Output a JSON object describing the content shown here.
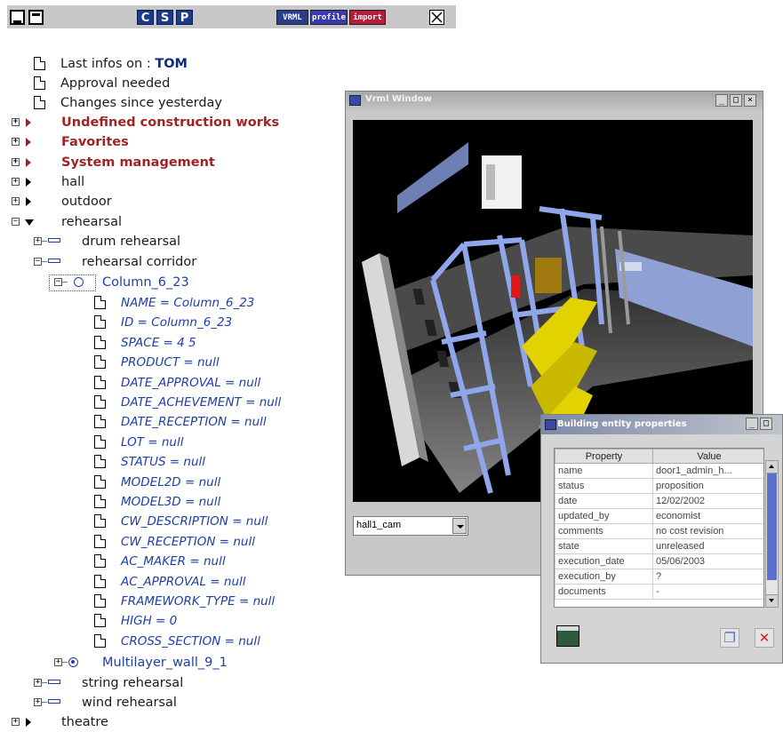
{
  "toolbar": {
    "csp": [
      "C",
      "S",
      "P"
    ],
    "tags": [
      {
        "label": "VRML",
        "color": "#2a3e8c"
      },
      {
        "label": "profile",
        "color": "#3b3ab0"
      },
      {
        "label": "import",
        "color": "#b51e3a"
      }
    ]
  },
  "tree": {
    "last_infos_prefix": "Last infos on : ",
    "last_infos_user": "TOM",
    "approval": "Approval needed",
    "changes": "Changes since yesterday",
    "groups": [
      "Undefined construction works",
      "Favorites",
      "System management"
    ],
    "hall": "hall",
    "outdoor": "outdoor",
    "rehearsal": "rehearsal",
    "drum": "drum rehearsal",
    "corridor": "rehearsal corridor",
    "column": "Column_6_23",
    "properties": [
      "NAME = Column_6_23",
      "ID = Column_6_23",
      "SPACE = 4 5",
      "PRODUCT = null",
      "DATE_APPROVAL = null",
      "DATE_ACHEVEMENT = null",
      "DATE_RECEPTION = null",
      "LOT = null",
      "STATUS = null",
      "MODEL2D = null",
      "MODEL3D = null",
      "CW_DESCRIPTION = null",
      "CW_RECEPTION = null",
      "AC_MAKER = null",
      "AC_APPROVAL = null",
      "FRAMEWORK_TYPE = null",
      "HIGH = 0",
      "CROSS_SECTION = null"
    ],
    "multilayer": "Multilayer_wall_9_1",
    "string": "string rehearsal",
    "wind": "wind rehearsal",
    "theatre": "theatre"
  },
  "vrml_window": {
    "title": "Vrml Window",
    "camera": "hall1_cam",
    "title_buttons": [
      "_",
      "□",
      "×"
    ]
  },
  "props_window": {
    "title": "Building entity properties",
    "col_property": "Property",
    "col_value": "Value",
    "rows": [
      [
        "name",
        "door1_admin_h..."
      ],
      [
        "status",
        "proposition"
      ],
      [
        "date",
        "12/02/2002"
      ],
      [
        "updated_by",
        "economist"
      ],
      [
        "comments",
        "no cost revision"
      ],
      [
        "state",
        "unreleased"
      ],
      [
        "execution_date",
        "05/06/2003"
      ],
      [
        "execution_by",
        "?"
      ],
      [
        "documents",
        "-"
      ]
    ],
    "delete_glyph": "✕",
    "new_glyph": "❐"
  }
}
